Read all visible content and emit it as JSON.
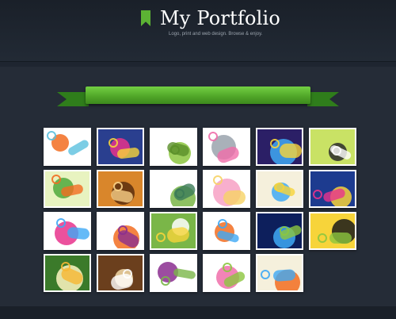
{
  "header": {
    "title": "My Portfolio",
    "tagline": "Logo, print and web design. Browse & enjoy.",
    "icon": "bookmark-icon",
    "accent_color": "#5cb334"
  },
  "ribbon": {
    "color": "#4ea427"
  },
  "gallery": {
    "thumbnails": [
      {
        "motif": "floral-swirls-orange",
        "colors": [
          "#ffffff",
          "#f26d21",
          "#5bc0de"
        ]
      },
      {
        "motif": "purple-paisley",
        "colors": [
          "#2a3f8f",
          "#e8338c",
          "#f7d43a"
        ]
      },
      {
        "motif": "green-vines-white",
        "colors": [
          "#ffffff",
          "#8cc63f",
          "#5a8f29"
        ]
      },
      {
        "motif": "retro-circles-grey",
        "colors": [
          "#ffffff",
          "#9aa3ad",
          "#f06eaa"
        ]
      },
      {
        "motif": "blue-curves-purple",
        "colors": [
          "#2b1f66",
          "#3fa9f5",
          "#f7d43a"
        ]
      },
      {
        "motif": "green-butterfly-silhouette",
        "colors": [
          "#c9e265",
          "#2a2a2a",
          "#ffffff"
        ]
      },
      {
        "motif": "green-waves-flowers",
        "colors": [
          "#e8f3c0",
          "#4fa83c",
          "#f26d21"
        ]
      },
      {
        "motif": "bonsai-tree-orange",
        "colors": [
          "#d9862b",
          "#5a2e0e",
          "#f7d087"
        ]
      },
      {
        "motif": "green-flourish-white",
        "colors": [
          "#ffffff",
          "#7ab648",
          "#3b7a57"
        ]
      },
      {
        "motif": "pink-flowers-outline",
        "colors": [
          "#ffffff",
          "#f7a1c4",
          "#f6d365"
        ]
      },
      {
        "motif": "blue-butterfly-swirls",
        "colors": [
          "#f5f0dc",
          "#3fa9f5",
          "#f7d43a"
        ]
      },
      {
        "motif": "tropical-flower-dark",
        "colors": [
          "#1d3b8f",
          "#f7d43a",
          "#e8338c"
        ]
      },
      {
        "motif": "colorful-swirls-white",
        "colors": [
          "#ffffff",
          "#e8338c",
          "#3fa9f5"
        ]
      },
      {
        "motif": "paisley-drops-white",
        "colors": [
          "#ffffff",
          "#f26d21",
          "#8b2e8f"
        ]
      },
      {
        "motif": "green-leaves-art",
        "colors": [
          "#7ab648",
          "#ffffff",
          "#f7d43a"
        ]
      },
      {
        "motif": "colorful-rings",
        "colors": [
          "#ffffff",
          "#f26d21",
          "#3fa9f5"
        ]
      },
      {
        "motif": "blue-rainbow-swirl",
        "colors": [
          "#0d1f5c",
          "#3fa9f5",
          "#8cc63f"
        ]
      },
      {
        "motif": "city-skyline-yellow",
        "colors": [
          "#f7d43a",
          "#1a1a1a",
          "#8cc63f"
        ]
      },
      {
        "motif": "plumeria-flowers",
        "colors": [
          "#3b7a2a",
          "#fff6c2",
          "#f7b733"
        ]
      },
      {
        "motif": "ornate-brown-scroll",
        "colors": [
          "#6b3f1d",
          "#f2d9a7",
          "#ffffff"
        ]
      },
      {
        "motif": "ornamental-vines-white",
        "colors": [
          "#ffffff",
          "#8b2e8f",
          "#7ab648"
        ]
      },
      {
        "motif": "pink-flower-pattern",
        "colors": [
          "#ffffff",
          "#f06eaa",
          "#8cc63f"
        ]
      },
      {
        "motif": "orange-floral-spray",
        "colors": [
          "#f5f0dc",
          "#f26d21",
          "#3fa9f5"
        ]
      }
    ]
  }
}
